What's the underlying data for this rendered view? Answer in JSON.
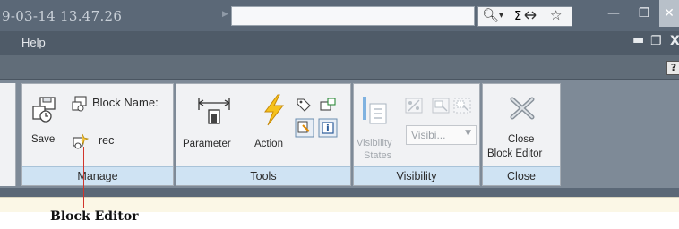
{
  "titlebar": {
    "title_fragment": "9-03-14 13.47.26",
    "arrow_icon": "right-arrow",
    "quick_icons": [
      "search-icon",
      "dropdown-arrow-icon",
      "exchange-icon",
      "favorites-star-icon"
    ],
    "window_buttons": [
      "minimize",
      "restore",
      "close"
    ]
  },
  "menubar": {
    "help_label": "Help",
    "mdi_buttons": [
      "minimize",
      "restore",
      "close"
    ]
  },
  "help_button": "?",
  "ribbon": {
    "manage": {
      "save_label": "Save",
      "block_name_label": "Block Name:",
      "rec_label": "rec",
      "footer": "Manage"
    },
    "tools": {
      "parameter_label": "Parameter",
      "action_label": "Action",
      "footer": "Tools"
    },
    "visibility": {
      "states_label_line1": "Visibility",
      "states_label_line2": "States",
      "dropdown_value": "Visibi...",
      "footer": "Visibility"
    },
    "close": {
      "close_label_line1": "Close",
      "close_label_line2": "Block Editor",
      "footer": "Close"
    }
  },
  "annotation": {
    "caption": "Block Editor",
    "color": "#d1352c"
  }
}
